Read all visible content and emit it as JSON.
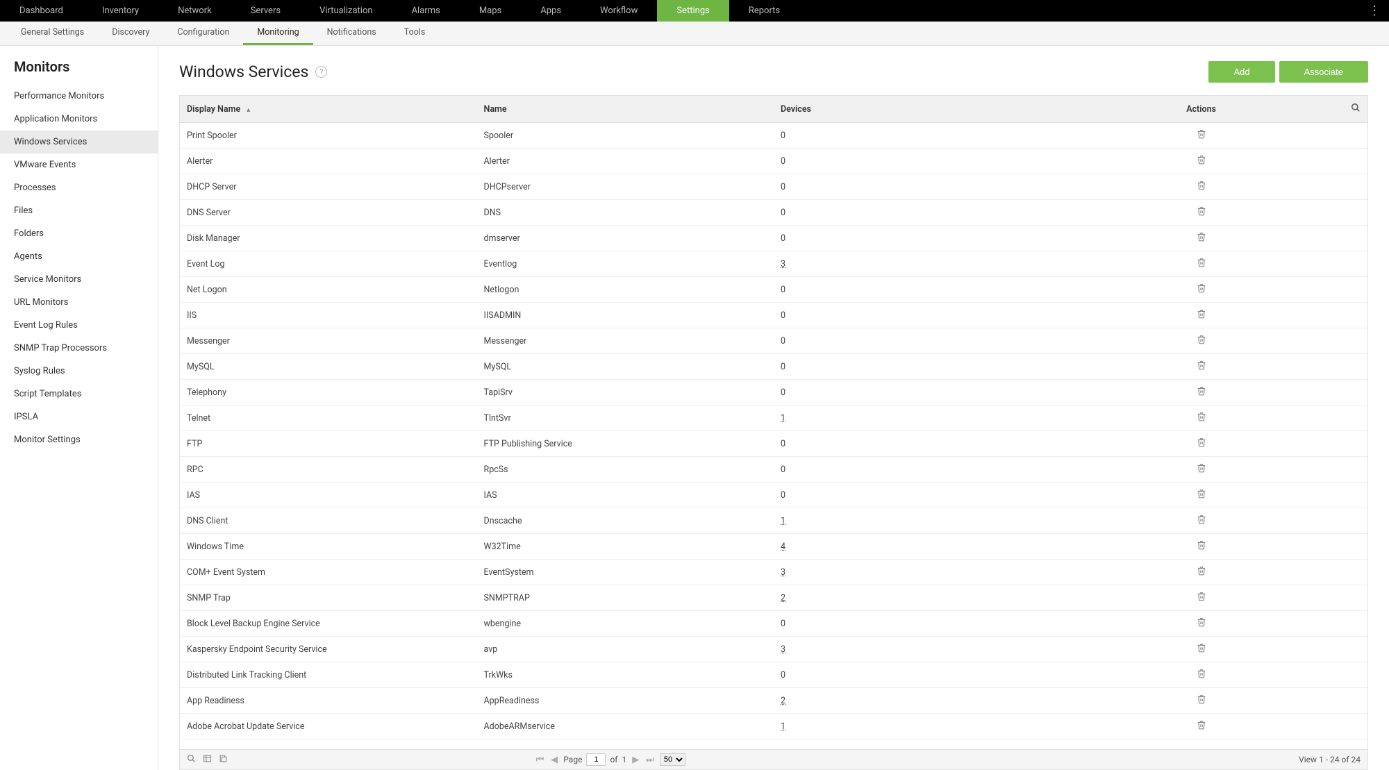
{
  "topnav": {
    "items": [
      "Dashboard",
      "Inventory",
      "Network",
      "Servers",
      "Virtualization",
      "Alarms",
      "Maps",
      "Apps",
      "Workflow",
      "Settings",
      "Reports"
    ],
    "active": "Settings"
  },
  "subnav": {
    "items": [
      "General Settings",
      "Discovery",
      "Configuration",
      "Monitoring",
      "Notifications",
      "Tools"
    ],
    "active": "Monitoring"
  },
  "sidebar": {
    "title": "Monitors",
    "items": [
      "Performance Monitors",
      "Application Monitors",
      "Windows Services",
      "VMware Events",
      "Processes",
      "Files",
      "Folders",
      "Agents",
      "Service Monitors",
      "URL Monitors",
      "Event Log Rules",
      "SNMP Trap Processors",
      "Syslog Rules",
      "Script Templates",
      "IPSLA",
      "Monitor Settings"
    ],
    "active": "Windows Services"
  },
  "page": {
    "title": "Windows Services",
    "add_label": "Add",
    "associate_label": "Associate"
  },
  "table": {
    "headers": {
      "display_name": "Display Name",
      "name": "Name",
      "devices": "Devices",
      "actions": "Actions"
    },
    "sort_indicator": "▲",
    "rows": [
      {
        "display": "Print Spooler",
        "name": "Spooler",
        "devices": "0",
        "link": false
      },
      {
        "display": "Alerter",
        "name": "Alerter",
        "devices": "0",
        "link": false
      },
      {
        "display": "DHCP Server",
        "name": "DHCPserver",
        "devices": "0",
        "link": false
      },
      {
        "display": "DNS Server",
        "name": "DNS",
        "devices": "0",
        "link": false
      },
      {
        "display": "Disk Manager",
        "name": "dmserver",
        "devices": "0",
        "link": false
      },
      {
        "display": "Event Log",
        "name": "Eventlog",
        "devices": "3",
        "link": true
      },
      {
        "display": "Net Logon",
        "name": "Netlogon",
        "devices": "0",
        "link": false
      },
      {
        "display": "IIS",
        "name": "IISADMIN",
        "devices": "0",
        "link": false
      },
      {
        "display": "Messenger",
        "name": "Messenger",
        "devices": "0",
        "link": false
      },
      {
        "display": "MySQL",
        "name": "MySQL",
        "devices": "0",
        "link": false
      },
      {
        "display": "Telephony",
        "name": "TapiSrv",
        "devices": "0",
        "link": false
      },
      {
        "display": "Telnet",
        "name": "TlntSvr",
        "devices": "1",
        "link": true
      },
      {
        "display": "FTP",
        "name": "FTP Publishing Service",
        "devices": "0",
        "link": false
      },
      {
        "display": "RPC",
        "name": "RpcSs",
        "devices": "0",
        "link": false
      },
      {
        "display": "IAS",
        "name": "IAS",
        "devices": "0",
        "link": false
      },
      {
        "display": "DNS Client",
        "name": "Dnscache",
        "devices": "1",
        "link": true
      },
      {
        "display": "Windows Time",
        "name": "W32Time",
        "devices": "4",
        "link": true
      },
      {
        "display": "COM+ Event System",
        "name": "EventSystem",
        "devices": "3",
        "link": true
      },
      {
        "display": "SNMP Trap",
        "name": "SNMPTRAP",
        "devices": "2",
        "link": true
      },
      {
        "display": "Block Level Backup Engine Service",
        "name": "wbengine",
        "devices": "0",
        "link": false
      },
      {
        "display": "Kaspersky Endpoint Security Service",
        "name": "avp",
        "devices": "3",
        "link": true
      },
      {
        "display": "Distributed Link Tracking Client",
        "name": "TrkWks",
        "devices": "0",
        "link": false
      },
      {
        "display": "App Readiness",
        "name": "AppReadiness",
        "devices": "2",
        "link": true
      },
      {
        "display": "Adobe Acrobat Update Service",
        "name": "AdobeARMservice",
        "devices": "1",
        "link": true
      }
    ]
  },
  "pager": {
    "page_label": "Page",
    "page_current": "1",
    "of_label": "of",
    "page_total": "1",
    "page_size": "50",
    "view_text": "View 1 - 24 of 24"
  }
}
